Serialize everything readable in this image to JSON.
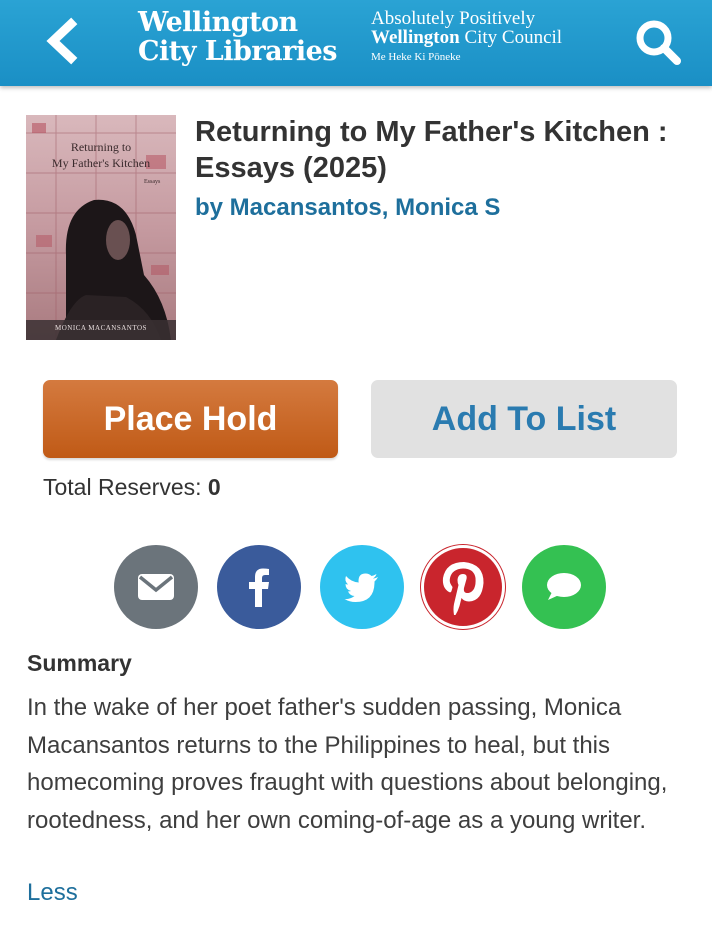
{
  "header": {
    "library_name_line1": "Wellington",
    "library_name_line2": "City Libraries",
    "council_line1": "Absolutely Positively",
    "council_bold": "Wellington",
    "council_rest": " City Council",
    "council_maori": "Me Heke Ki Pōneke",
    "back_icon": "chevron-left-icon",
    "search_icon": "search-icon"
  },
  "book": {
    "title": "Returning to My Father's Kitchen : Essays (2025)",
    "author": "by Macansantos, Monica S",
    "cover": {
      "title_line1": "Returning to",
      "title_line2": "My Father's Kitchen",
      "subtitle": "Essays",
      "author": "MONICA MACANSANTOS"
    }
  },
  "actions": {
    "place_hold_label": "Place Hold",
    "add_to_list_label": "Add To List",
    "reserves_label": "Total Reserves: ",
    "reserves_count": "0"
  },
  "share": [
    {
      "name": "email-icon",
      "color": "#6b747b"
    },
    {
      "name": "facebook-icon",
      "color": "#3a5b9b"
    },
    {
      "name": "twitter-icon",
      "color": "#2fc2ef"
    },
    {
      "name": "pinterest-icon",
      "color": "#c9252d"
    },
    {
      "name": "sms-icon",
      "color": "#34c152"
    }
  ],
  "summary": {
    "heading": "Summary",
    "text": "In the wake of her poet father's sudden passing, Monica Macansantos returns to the Philippines to heal, but this homecoming proves fraught with questions about belonging, rootedness, and her own coming-of-age as a young writer.",
    "toggle_label": "Less"
  },
  "colors": {
    "header": "#1a8fc5",
    "hold_button": "#c05a16",
    "link": "#1e6f9c"
  }
}
